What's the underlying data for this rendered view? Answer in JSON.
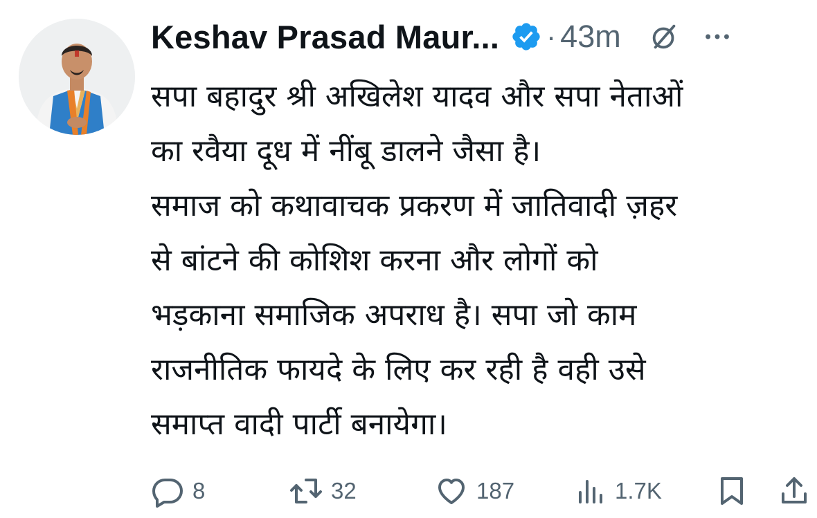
{
  "post": {
    "author": {
      "display_name": "Keshav Prasad Maur...",
      "verified_badge_icon": "verified-badge-icon",
      "avatar": "avatar-photo"
    },
    "separator": "·",
    "timestamp": "43m",
    "text_lines": [
      "सपा बहादुर श्री अखिलेश यादव और सपा नेताओं",
      "का रवैया दूध में नींबू डालने जैसा है।",
      "समाज को कथावाचक प्रकरण में जातिवादी ज़हर",
      "से बांटने की कोशिश करना और लोगों को",
      "भड़काना समाजिक अपराध है। सपा जो काम",
      "राजनीतिक फायदे के लिए कर रही है वही उसे",
      "समाप्त वादी पार्टी बनायेगा।"
    ],
    "actions": {
      "reply": {
        "icon": "reply-icon",
        "count": "8"
      },
      "repost": {
        "icon": "repost-icon",
        "count": "32"
      },
      "like": {
        "icon": "heart-icon",
        "count": "187"
      },
      "views": {
        "icon": "views-chart-icon",
        "count": "1.7K"
      },
      "bookmark": {
        "icon": "bookmark-icon"
      },
      "share": {
        "icon": "share-icon"
      }
    },
    "header_icons": [
      "grok-icon",
      "more-icon"
    ],
    "colors": {
      "text": "#0f1419",
      "secondary": "#536471",
      "verified": "#1d9bf0"
    }
  }
}
